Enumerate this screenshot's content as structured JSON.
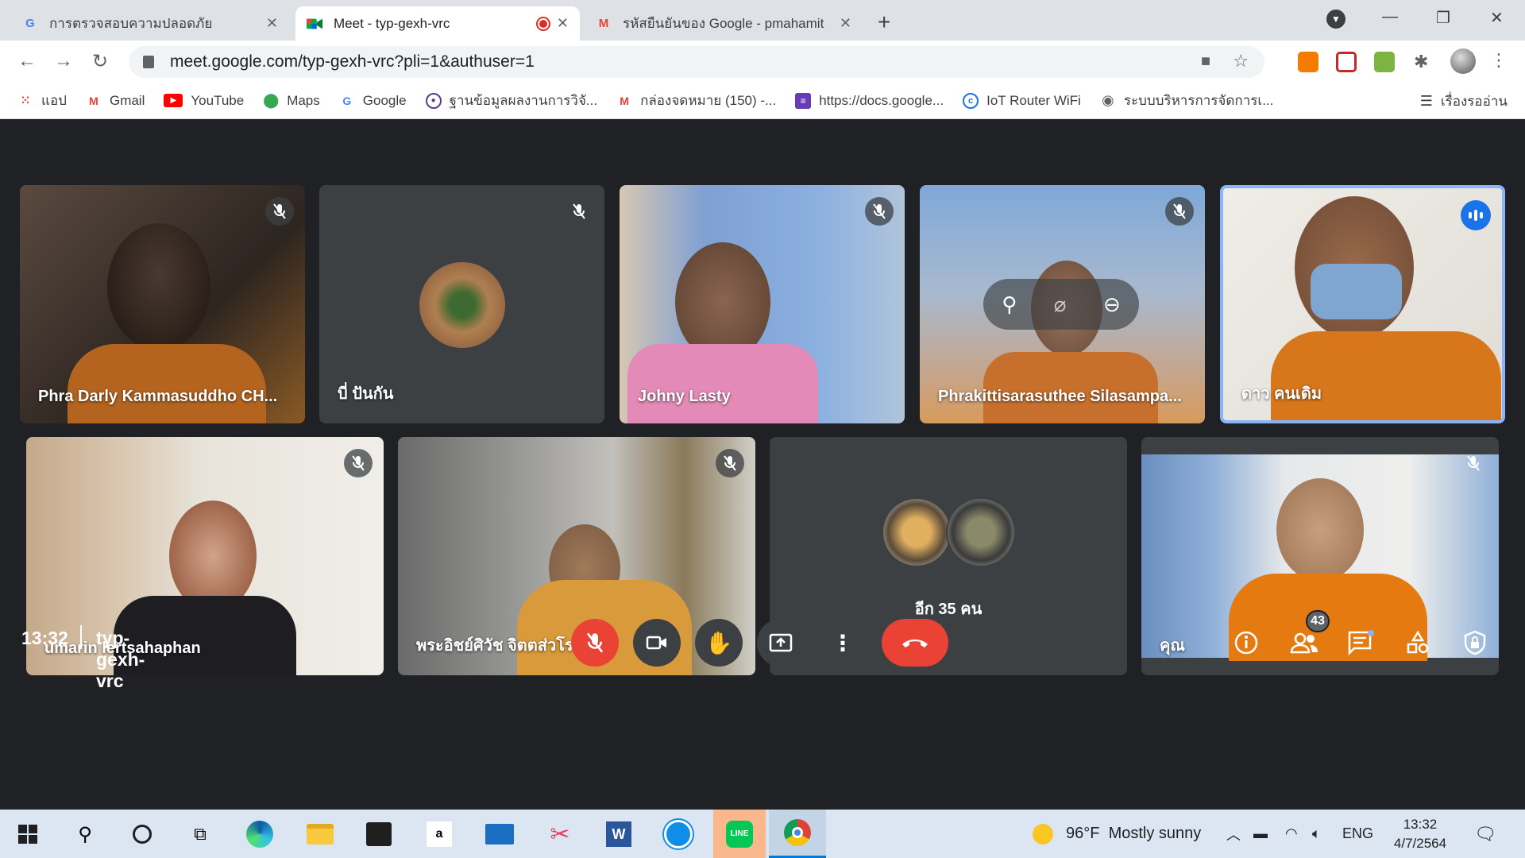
{
  "browser": {
    "tabs": [
      {
        "title": "การตรวจสอบความปลอดภัย",
        "icon": "google-g-icon",
        "active": false
      },
      {
        "title": "Meet - typ-gexh-vrc",
        "icon": "meet-icon",
        "active": true
      },
      {
        "title": "รหัสยืนยันของ Google - pmahamit",
        "icon": "gmail-icon",
        "active": false
      }
    ],
    "url": "meet.google.com/typ-gexh-vrc?pli=1&authuser=1",
    "bookmarks": [
      {
        "label": "แอป",
        "icon": "apps-grid-icon",
        "color": "#ea4335"
      },
      {
        "label": "Gmail",
        "icon": "gmail-icon",
        "color": "#ea4335"
      },
      {
        "label": "YouTube",
        "icon": "youtube-icon",
        "color": "#ff0000"
      },
      {
        "label": "Maps",
        "icon": "maps-pin-icon",
        "color": "#34a853"
      },
      {
        "label": "Google",
        "icon": "google-g-icon",
        "color": "#4285f4"
      },
      {
        "label": "ฐานข้อมูลผลงานการวิจั...",
        "icon": "seal-icon",
        "color": "#5b3c8c"
      },
      {
        "label": "กล่องจดหมาย (150) -...",
        "icon": "gmail-icon",
        "color": "#ea4335"
      },
      {
        "label": "https://docs.google...",
        "icon": "forms-icon",
        "color": "#673ab7"
      },
      {
        "label": "IoT Router WiFi",
        "icon": "router-icon",
        "color": "#1a73e8"
      },
      {
        "label": "ระบบบริหารการจัดการเ...",
        "icon": "globe-icon",
        "color": "#5f6368"
      }
    ],
    "reading_list": "เรื่องรออ่าน"
  },
  "meeting": {
    "participants_row1": [
      {
        "name": "Phra Darly Kammasuddho CH..."
      },
      {
        "name": "บี่ ปันกัน"
      },
      {
        "name": "Johny Lasty"
      },
      {
        "name": "Phrakittisarasuthee Silasampa..."
      },
      {
        "name": "ดาว คนเดิม"
      }
    ],
    "participants_row2": [
      {
        "name": "umarin lertsahaphan"
      },
      {
        "name": "พระอิชย์ศิวัช จิตตส่วโร"
      },
      {
        "name": "อีก 35 คน"
      },
      {
        "name": "คุณ"
      }
    ],
    "time": "13:32",
    "code": "typ-gexh-vrc",
    "people_count": "43"
  },
  "taskbar": {
    "weather": "96°F  Mostly sunny",
    "lang": "ENG",
    "time": "13:32",
    "date": "4/7/2564"
  }
}
